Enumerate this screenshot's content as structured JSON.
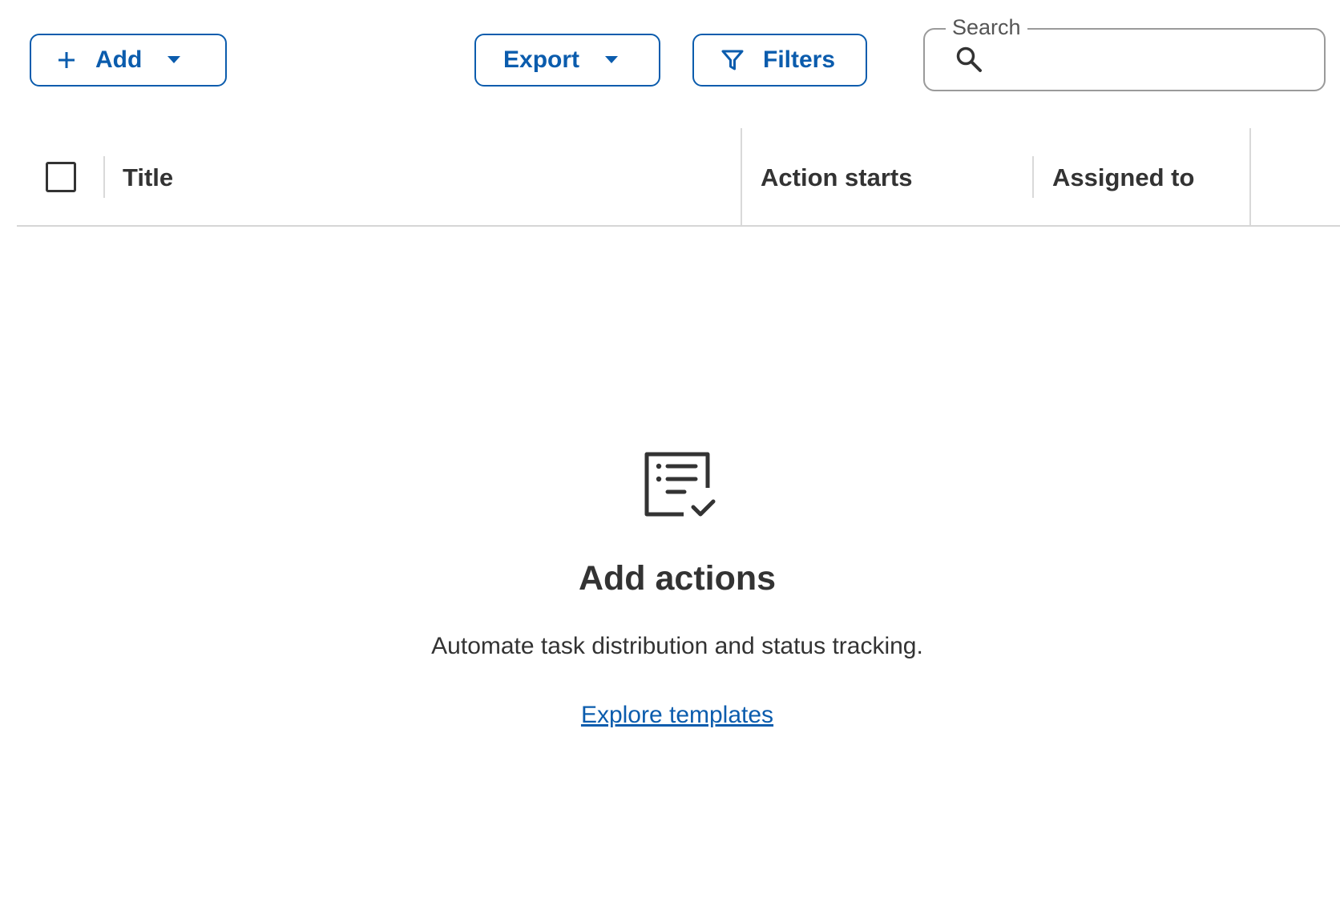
{
  "toolbar": {
    "add_label": "Add",
    "export_label": "Export",
    "filters_label": "Filters",
    "icons": {
      "add": "plus-icon",
      "add_menu": "caret-down-icon",
      "export_menu": "caret-down-icon",
      "filters": "filter-icon"
    }
  },
  "search": {
    "label": "Search",
    "value": "",
    "icon": "search-icon"
  },
  "table": {
    "columns": [
      "Title",
      "Action starts",
      "Assigned to"
    ],
    "select_all_checked": false,
    "rows": []
  },
  "empty_state": {
    "icon": "checklist-icon",
    "title": "Add actions",
    "description": "Automate task distribution and status tracking.",
    "link_label": "Explore templates"
  },
  "colors": {
    "accent": "#0b5cad",
    "text": "#333333",
    "border": "#9a9a9a",
    "divider": "#d6d6d6"
  }
}
